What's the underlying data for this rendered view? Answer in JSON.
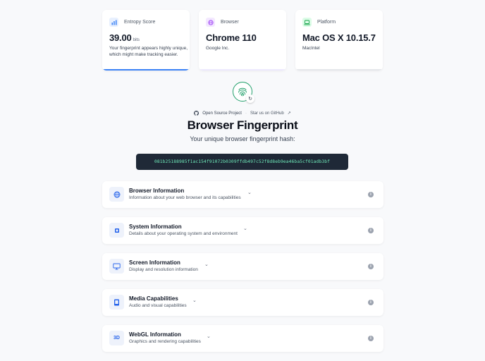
{
  "stats": {
    "entropy": {
      "label": "Entropy Score",
      "value": "39.00",
      "unit": "bits",
      "description": "Your fingerprint appears highly unique, which might make tracking easier.",
      "accent": "#3b82f6",
      "icon": "bar-chart-icon"
    },
    "browser": {
      "label": "Browser",
      "value": "Chrome 110",
      "sub": "Google Inc.",
      "accent": "#a78bfa",
      "icon": "globe-icon"
    },
    "platform": {
      "label": "Platform",
      "value": "Mac OS X 10.15.7",
      "sub": "MacIntel",
      "accent": "#22c55e",
      "icon": "laptop-icon"
    }
  },
  "header": {
    "project_label": "Open Source Project",
    "github_link": "Star us on GitHub",
    "title": "Browser Fingerprint",
    "subtitle": "Your unique browser fingerprint hash:",
    "hash": "081b25188985f1ac154f91072b0309ffdb497c52f8d8eb9ea46ba5cf01adb3bf"
  },
  "sections": [
    {
      "title": "Browser Information",
      "description": "Information about your web browser and its capabilities",
      "icon": "globe-icon"
    },
    {
      "title": "System Information",
      "description": "Details about your operating system and environment",
      "icon": "cpu-icon"
    },
    {
      "title": "Screen Information",
      "description": "Display and resolution information",
      "icon": "monitor-icon"
    },
    {
      "title": "Media Capabilities",
      "description": "Audio and visual capabilities",
      "icon": "tablet-icon"
    },
    {
      "title": "WebGL Information",
      "description": "Graphics and rendering capabilities",
      "icon": "3d-icon",
      "icon_text": "3D"
    }
  ],
  "colors": {
    "hash_bg": "#1f2937",
    "hash_text": "#6ee7b7",
    "logo_green": "#22a06b",
    "section_icon": "#2563eb"
  }
}
